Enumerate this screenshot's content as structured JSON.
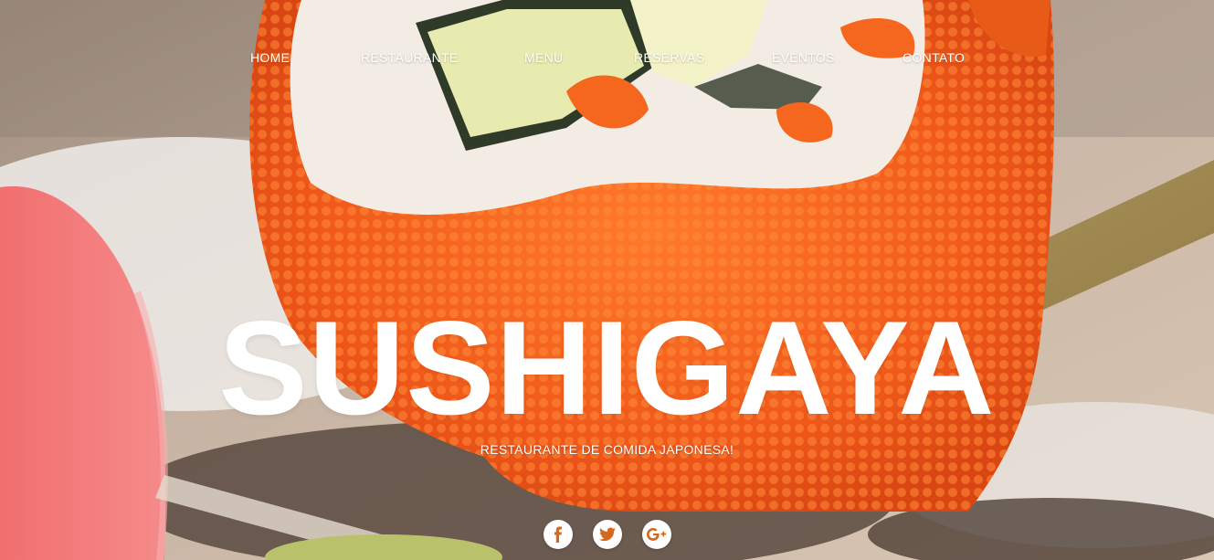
{
  "nav": {
    "items": [
      {
        "label": "HOME"
      },
      {
        "label": "RESTAURANTE"
      },
      {
        "label": "MENU"
      },
      {
        "label": "RESERVAS"
      },
      {
        "label": "EVENTOS"
      },
      {
        "label": "CONTATO"
      }
    ]
  },
  "hero": {
    "title": "SUSHIGAYA",
    "tagline": "RESTAURANTE DE COMIDA JAPONESA!"
  },
  "social": {
    "icons": [
      "facebook-icon",
      "twitter-icon",
      "google-plus-icon"
    ]
  },
  "colors": {
    "text": "#ffffff",
    "roe": "#f0651c",
    "rice": "#f2ece4",
    "ginger": "#f06a6a"
  }
}
